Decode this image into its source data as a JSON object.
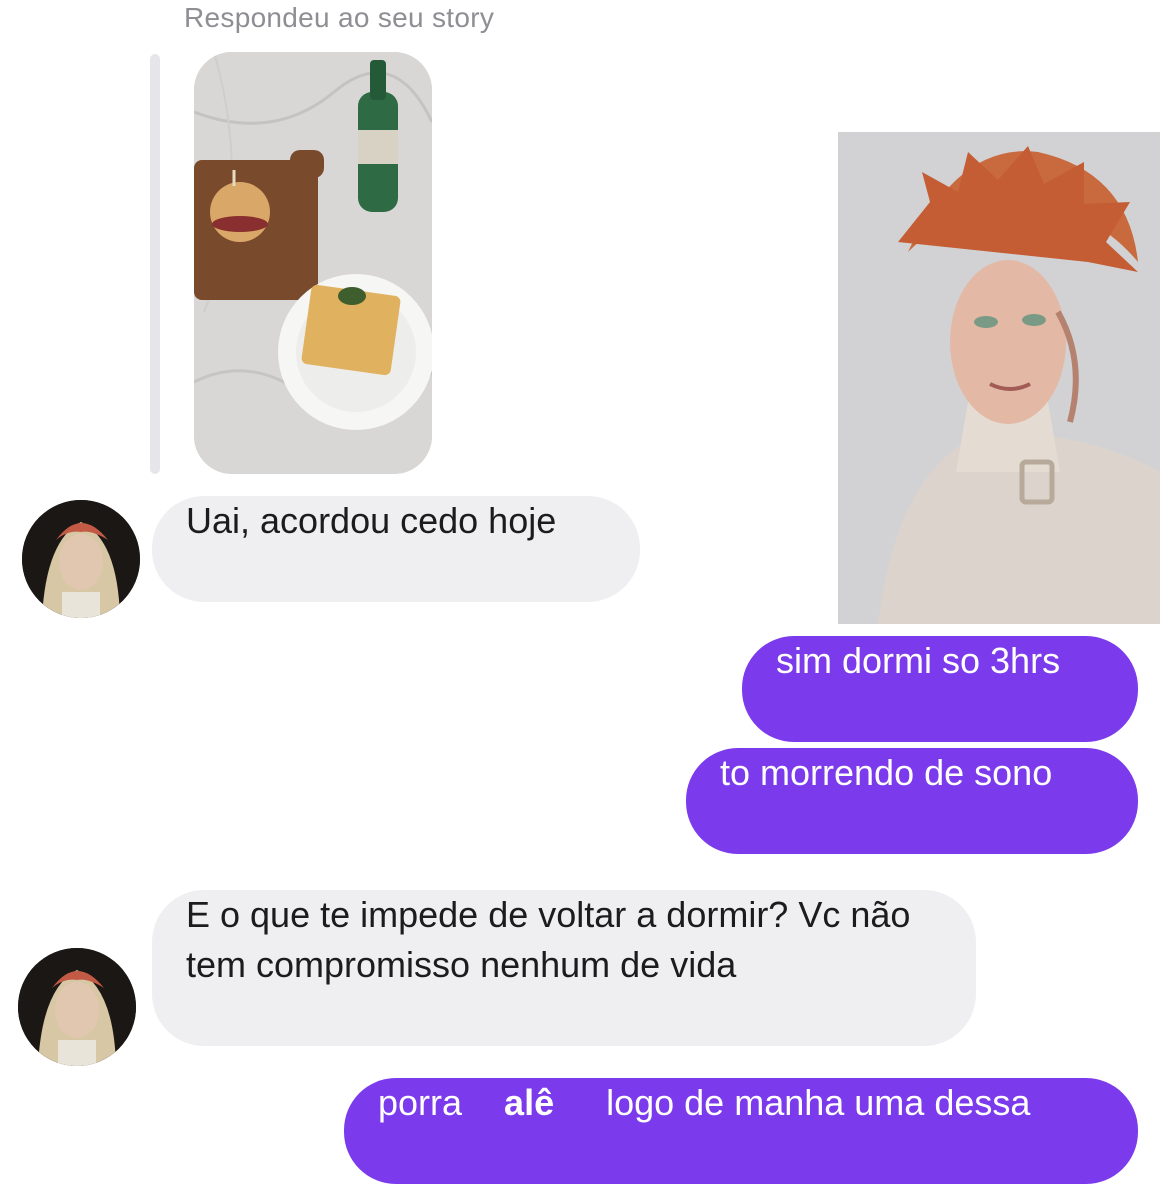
{
  "story_reply": {
    "caption": "Respondeu ao seu story"
  },
  "messages": [
    {
      "direction": "incoming",
      "text": "Uai, acordou cedo hoje"
    },
    {
      "direction": "outgoing",
      "text": "sim dormi so 3hrs"
    },
    {
      "direction": "outgoing",
      "text": "to morrendo de sono"
    },
    {
      "direction": "incoming",
      "text": "E o que te impede de voltar a dormir? Vc não tem compromisso nenhum de vida"
    },
    {
      "direction": "outgoing",
      "parts": [
        "porra",
        "alê",
        "logo de manha uma dessa"
      ]
    }
  ],
  "colors": {
    "outgoing_bubble": "#7c3aed",
    "incoming_bubble": "#efeff1",
    "caption_text": "#8e8e93"
  }
}
